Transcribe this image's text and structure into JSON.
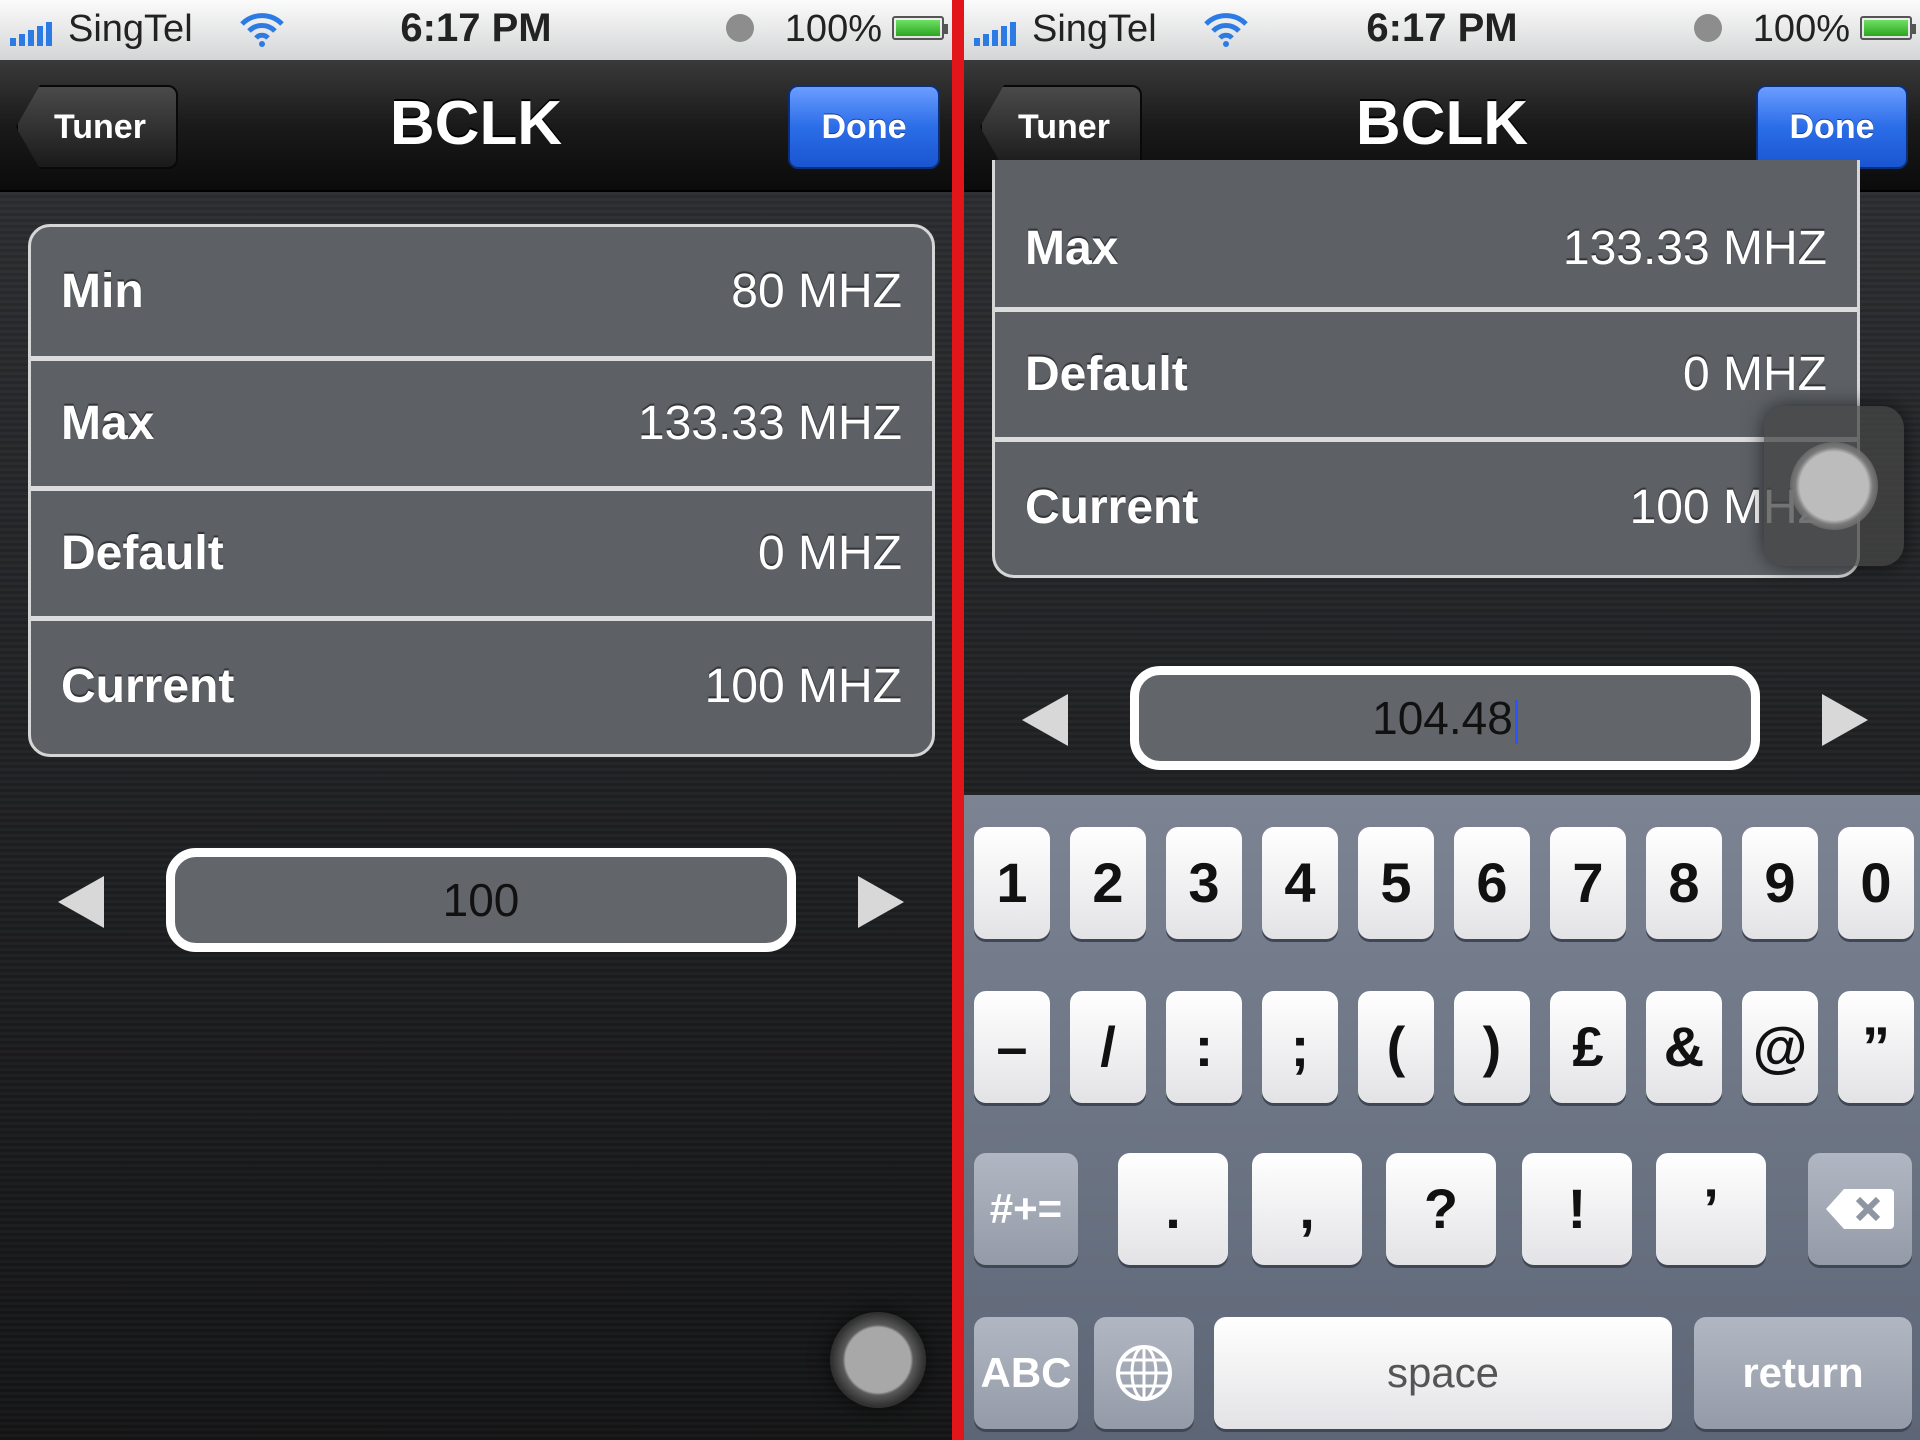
{
  "status": {
    "carrier": "SingTel",
    "time": "6:17 PM",
    "battery": "100%"
  },
  "nav": {
    "back": "Tuner",
    "title": "BCLK",
    "done": "Done"
  },
  "left": {
    "rows": [
      {
        "label": "Min",
        "value": "80 MHZ"
      },
      {
        "label": "Max",
        "value": "133.33 MHZ"
      },
      {
        "label": "Default",
        "value": "0 MHZ"
      },
      {
        "label": "Current",
        "value": "100 MHZ"
      }
    ],
    "input_value": "100"
  },
  "right": {
    "rows": [
      {
        "label": "Max",
        "value": "133.33 MHZ"
      },
      {
        "label": "Default",
        "value": "0 MHZ"
      },
      {
        "label": "Current",
        "value": "100 MHZ"
      }
    ],
    "input_value": "104.48"
  },
  "keyboard": {
    "row1": [
      "1",
      "2",
      "3",
      "4",
      "5",
      "6",
      "7",
      "8",
      "9",
      "0"
    ],
    "row2": [
      "–",
      "/",
      ":",
      ";",
      "(",
      ")",
      "£",
      "&",
      "@",
      "”"
    ],
    "row3": [
      ".",
      ",",
      "?",
      "!",
      "’"
    ],
    "symbols": "#+=",
    "abc": "ABC",
    "space": "space",
    "return": "return"
  },
  "icons": [
    "signal-bars-icon",
    "wifi-icon",
    "clock-icon",
    "battery-icon",
    "globe-icon",
    "backspace-icon",
    "assistive-touch-icon"
  ]
}
